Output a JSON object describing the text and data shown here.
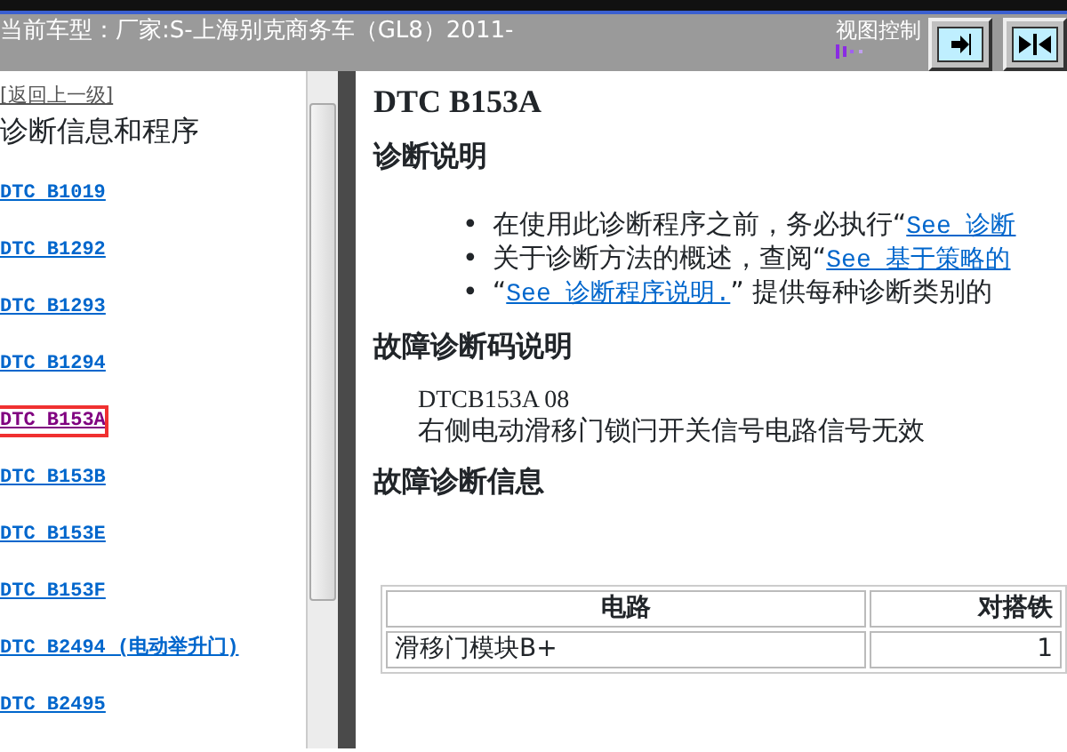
{
  "header": {
    "vehicle": "当前车型：厂家:S-上海别克商务车（GL8）2011-",
    "view_control_label": "视图控制"
  },
  "sidebar": {
    "back_link": "[返回上一级]",
    "title": "诊断信息和程序",
    "items": [
      {
        "label": "DTC B1019",
        "visited": false,
        "highlighted": false
      },
      {
        "label": "DTC B1292",
        "visited": false,
        "highlighted": false
      },
      {
        "label": "DTC B1293",
        "visited": false,
        "highlighted": false
      },
      {
        "label": "DTC B1294",
        "visited": false,
        "highlighted": false
      },
      {
        "label": "DTC B153A",
        "visited": true,
        "highlighted": true
      },
      {
        "label": "DTC B153B",
        "visited": false,
        "highlighted": false
      },
      {
        "label": "DTC B153E",
        "visited": false,
        "highlighted": false
      },
      {
        "label": "DTC B153F",
        "visited": false,
        "highlighted": false
      },
      {
        "label": "DTC B2494 (电动举升门)",
        "visited": false,
        "highlighted": false
      },
      {
        "label": "DTC B2495",
        "visited": false,
        "highlighted": false
      }
    ]
  },
  "content": {
    "title": "DTC B153A",
    "sections": [
      {
        "heading": "诊断说明",
        "kind": "bullets",
        "bullets": [
          {
            "marker": "•",
            "before": "在使用此诊断程序之前，务必执行“",
            "link": "See 诊断"
          },
          {
            "marker": "•",
            "before": "关于诊断方法的概述，查阅“",
            "link": "See 基于策略的"
          },
          {
            "marker": "•",
            "before": "“",
            "link": "See 诊断程序说明.",
            "after": "” 提供每种诊断类别的"
          }
        ]
      },
      {
        "heading": "故障诊断码说明",
        "kind": "code",
        "code": "DTCB153A 08",
        "description": "右侧电动滑移门锁闩开关信号电路信号无效"
      },
      {
        "heading": "故障诊断信息",
        "kind": "table",
        "table": {
          "columns": [
            "电路",
            "对搭铁"
          ],
          "rows": [
            [
              "滑移门模块B+",
              "1"
            ]
          ]
        }
      }
    ]
  }
}
